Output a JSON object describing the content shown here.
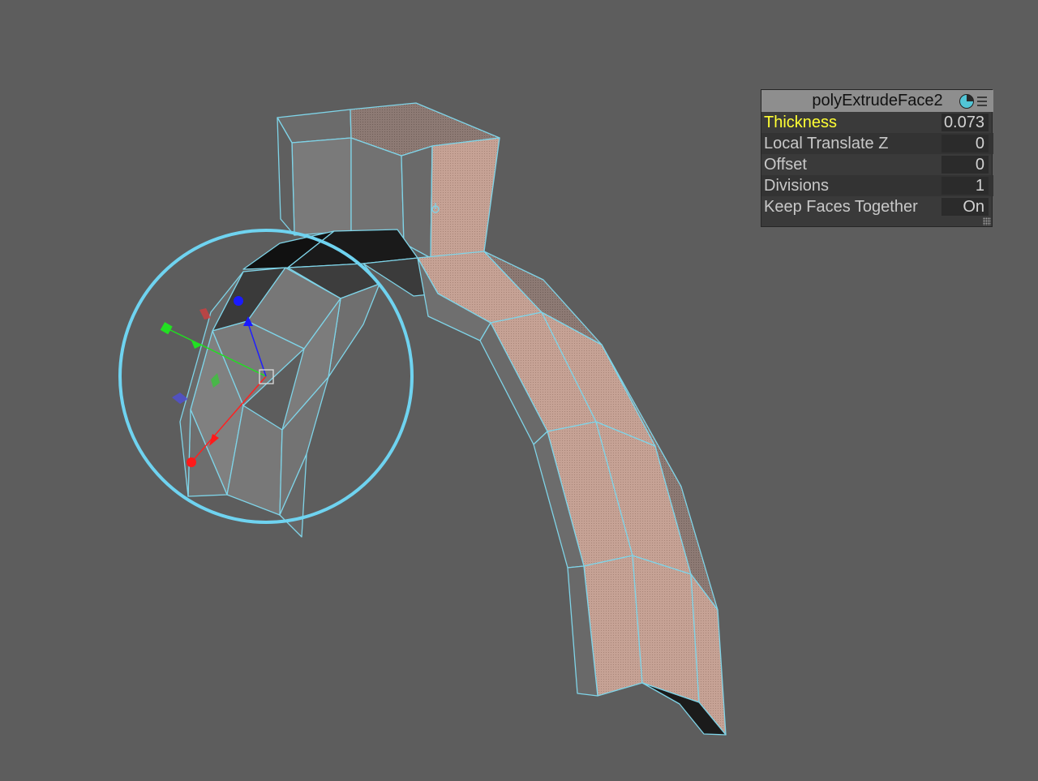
{
  "viewport": {
    "background_color": "#5d5d5d",
    "wireframe_color": "#7fd4e8",
    "selected_face_color": "#c8a69a"
  },
  "hud": {
    "node_name": "polyExtrudeFace2",
    "icons": [
      "pie-icon",
      "menu-icon"
    ],
    "attributes": [
      {
        "label": "Thickness",
        "value": "0.073",
        "active": true
      },
      {
        "label": "Local Translate Z",
        "value": "0"
      },
      {
        "label": "Offset",
        "value": "0"
      },
      {
        "label": "Divisions",
        "value": "1"
      },
      {
        "label": "Keep Faces Together",
        "value": "On"
      }
    ],
    "active_label_color": "#ffff33"
  },
  "manipulator": {
    "axis_colors": {
      "x": "#ff2020",
      "y": "#20e020",
      "z": "#2020ff"
    },
    "ring_color": "#6fd3f0"
  }
}
